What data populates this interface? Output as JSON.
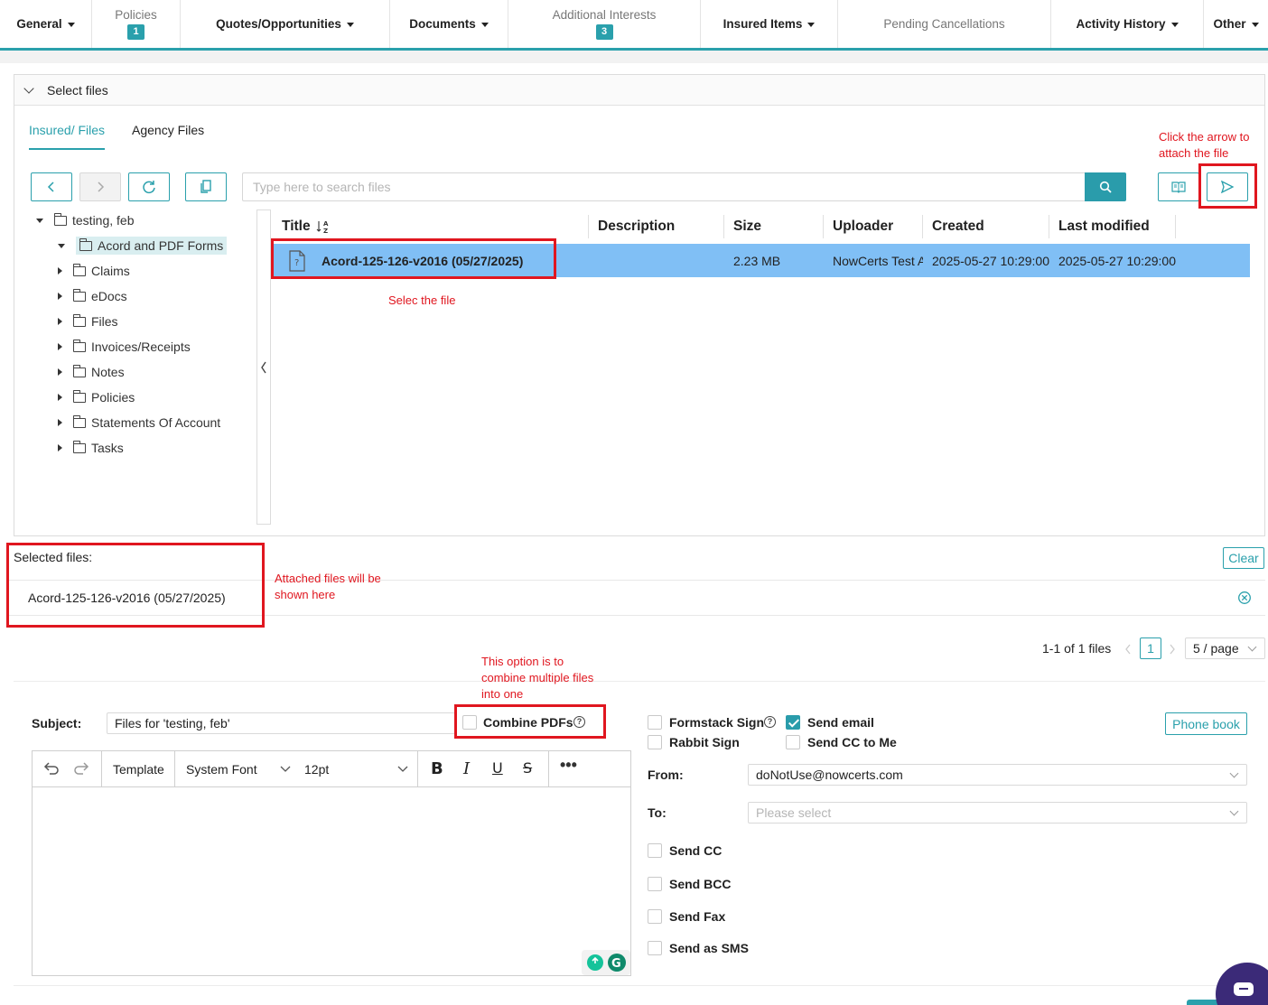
{
  "nav": {
    "general": "General",
    "policies": "Policies",
    "policies_count": "1",
    "quotes": "Quotes/Opportunities",
    "documents": "Documents",
    "additional_interests": "Additional Interests",
    "additional_interests_count": "3",
    "insured_items": "Insured Items",
    "pending_cancellations": "Pending Cancellations",
    "activity_history": "Activity History",
    "other": "Other"
  },
  "panel": {
    "title": "Select files",
    "tabs": [
      "Insured/ Files",
      "Agency Files"
    ],
    "search_placeholder": "Type here to search files"
  },
  "tree": {
    "root": "testing, feb",
    "items": [
      "Acord and PDF Forms",
      "Claims",
      "eDocs",
      "Files",
      "Invoices/Receipts",
      "Notes",
      "Policies",
      "Statements Of Account",
      "Tasks"
    ]
  },
  "table": {
    "columns": [
      "Title",
      "Description",
      "Size",
      "Uploader",
      "Created",
      "Last modified"
    ],
    "rows": [
      {
        "title": "Acord-125-126-v2016 (05/27/2025)",
        "description": "",
        "size": "2.23 MB",
        "uploader": "NowCerts Test A",
        "created": "2025-05-27 10:29:00",
        "modified": "2025-05-27 10:29:00"
      }
    ]
  },
  "annotations": {
    "arrow_note_1": "Click the arrow to",
    "arrow_note_2": "attach the file",
    "select_note": "Selec the file",
    "attached_note_1": "Attached files will be",
    "attached_note_2": "shown here",
    "combine_note_1": "This option is to",
    "combine_note_2": "combine multiple files",
    "combine_note_3": "into one"
  },
  "selected": {
    "label": "Selected files:",
    "clear": "Clear",
    "file": "Acord-125-126-v2016 (05/27/2025)"
  },
  "pagination": {
    "summary": "1-1 of 1 files",
    "current_page": "1",
    "page_size": "5 / page"
  },
  "email": {
    "subject_label": "Subject:",
    "subject_value": "Files for 'testing, feb'",
    "combine_pdfs": "Combine PDFs",
    "formstack_sign": "Formstack Sign",
    "send_email": "Send email",
    "rabbit_sign": "Rabbit Sign",
    "send_cc_to_me": "Send CC to Me",
    "phone_book": "Phone book",
    "from_label": "From:",
    "from_value": "doNotUse@nowcerts.com",
    "to_label": "To:",
    "to_placeholder": "Please select",
    "send_cc": "Send CC",
    "send_bcc": "Send BCC",
    "send_fax": "Send Fax",
    "send_sms": "Send as SMS"
  },
  "editor": {
    "template": "Template",
    "font": "System Font",
    "size": "12pt"
  },
  "colors": {
    "accent": "#2aa0ac",
    "selected_row": "#80bff5",
    "annotation_red": "#e0161f"
  }
}
